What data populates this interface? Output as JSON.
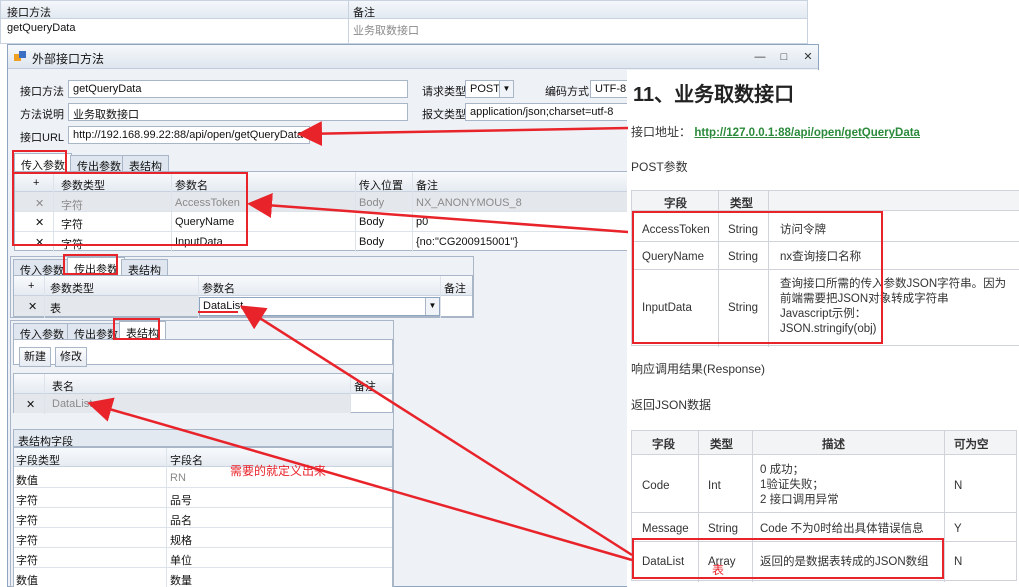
{
  "top_grid": {
    "col1_header": "接口方法",
    "col2_header": "备注",
    "row_method": "getQueryData",
    "row_note": "业务取数接口"
  },
  "window": {
    "title": "外部接口方法",
    "controls": [
      "—",
      "□",
      "✕"
    ]
  },
  "form": {
    "method_label": "接口方法",
    "method_value": "getQueryData",
    "desc_label": "方法说明",
    "desc_value": "业务取数接口",
    "url_label": "接口URL",
    "url_value": "http://192.168.99.22:88/api/open/getQueryData",
    "req_type_label": "请求类型",
    "req_type_value": "POST",
    "encoding_label": "编码方式",
    "encoding_value": "UTF-8",
    "msg_type_label": "报文类型",
    "msg_type_value": "application/json;charset=utf-8"
  },
  "tabs": [
    "传入参数",
    "传出参数",
    "表结构"
  ],
  "input_grid": {
    "headers": [
      "+",
      "参数类型",
      "参数名",
      "传入位置",
      "备注"
    ],
    "rows": [
      {
        "x": "✕",
        "type": "字符",
        "name": "AccessToken",
        "pos": "Body",
        "note": "NX_ANONYMOUS_8"
      },
      {
        "x": "✕",
        "type": "字符",
        "name": "QueryName",
        "pos": "Body",
        "note": "p0"
      },
      {
        "x": "✕",
        "type": "字符",
        "name": "InputData",
        "pos": "Body",
        "note": "{no:\"CG200915001\"}"
      }
    ]
  },
  "output_grid": {
    "headers": [
      "+",
      "参数类型",
      "参数名",
      "备注"
    ],
    "row": {
      "x": "✕",
      "type": "表",
      "name": "DataList"
    }
  },
  "struct_panel": {
    "new_button": "新建",
    "edit_button": "修改",
    "table_header_name": "表名",
    "table_header_note": "备注",
    "table_row": {
      "x": "✕",
      "name": "DataList"
    },
    "fields_title": "表结构字段",
    "fields_headers": [
      "字段类型",
      "字段名"
    ],
    "fields": [
      {
        "type": "数值",
        "name": "RN"
      },
      {
        "type": "字符",
        "name": "品号"
      },
      {
        "type": "字符",
        "name": "品名"
      },
      {
        "type": "字符",
        "name": "规格"
      },
      {
        "type": "字符",
        "name": "单位"
      },
      {
        "type": "数值",
        "name": "数量"
      }
    ]
  },
  "annotation": {
    "need_define": "需要的就定义出来",
    "table_mark": "表"
  },
  "doc": {
    "title": "11、业务取数接口",
    "addr_label": "接口地址：",
    "addr_link": "http://127.0.0.1:88/api/open/getQueryData",
    "post_params": "POST参数",
    "param_headers": [
      "字段",
      "类型"
    ],
    "params": [
      {
        "field": "AccessToken",
        "type": "String",
        "desc": "访问令牌"
      },
      {
        "field": "QueryName",
        "type": "String",
        "desc": "nx查询接口名称"
      },
      {
        "field": "InputData",
        "type": "String",
        "desc_lines": [
          "查询接口所需的传入参数JSON字符串。因为",
          "前端需要把JSON对象转成字符串",
          "Javascript示例：",
          "JSON.stringify(obj)"
        ]
      }
    ],
    "response_label": "响应调用结果(Response)",
    "return_label": "返回JSON数据",
    "resp_headers": [
      "字段",
      "类型",
      "描述",
      "可为空"
    ],
    "responses": [
      {
        "field": "Code",
        "type": "Int",
        "desc_lines": [
          "0 成功；",
          "1验证失败；",
          "2 接口调用异常"
        ],
        "nullable": "N"
      },
      {
        "field": "Message",
        "type": "String",
        "desc_lines": [
          "Code 不为0时给出具体错误信息"
        ],
        "nullable": "Y"
      },
      {
        "field": "DataList",
        "type": "Array",
        "desc_lines": [
          "返回的是数据表转成的JSON数组"
        ],
        "nullable": "N"
      }
    ]
  },
  "colors": {
    "annotation_red": "#e8232a",
    "link_green": "#2a8a3a"
  }
}
